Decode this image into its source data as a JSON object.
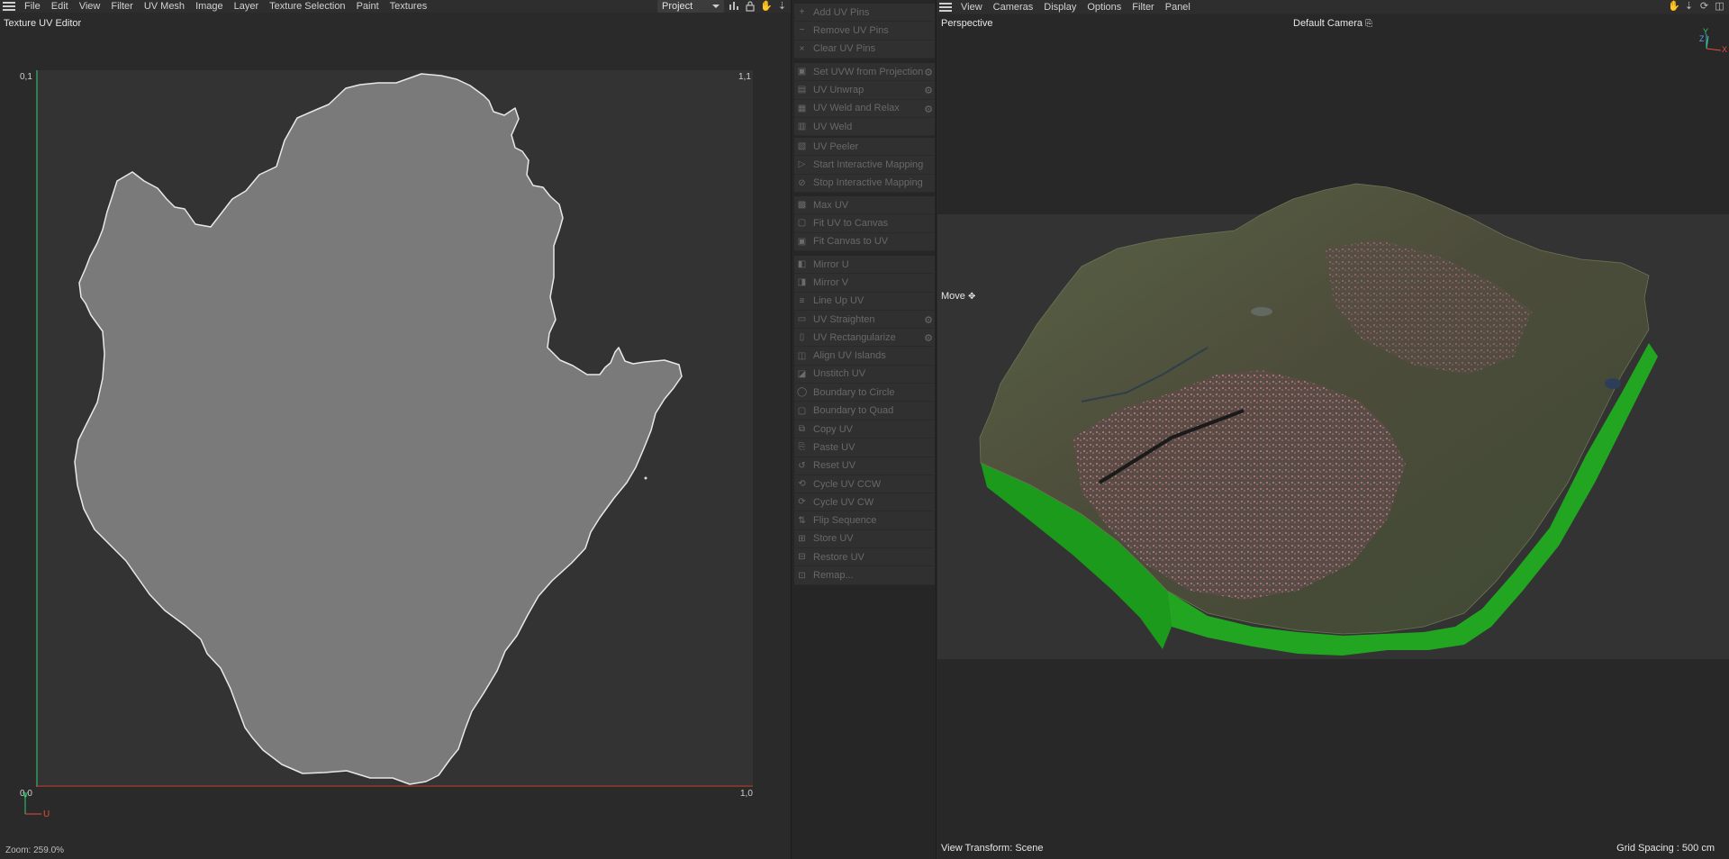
{
  "uv_editor": {
    "menu": [
      "File",
      "Edit",
      "View",
      "Filter",
      "UV Mesh",
      "Image",
      "Layer",
      "Texture Selection",
      "Paint",
      "Textures"
    ],
    "project_select": "Project",
    "title": "Texture UV Editor",
    "corner_labels": {
      "top_left": "0,1",
      "top_right": "1,1",
      "bottom_left": "0,0",
      "bottom_right": "1,0"
    },
    "axis_v": "V",
    "axis_u": "U",
    "zoom": "Zoom: 259.0%",
    "colors": {
      "canvas": "#333333",
      "island_fill": "#7a7a7a",
      "island_outline": "#e8e8e8",
      "u_axis": "#c0392b",
      "v_axis": "#2ecc71"
    }
  },
  "uv_commands": {
    "groups": [
      [
        {
          "label": "Add UV Pins",
          "icon": "pin-add-icon",
          "gear": false
        },
        {
          "label": "Remove UV Pins",
          "icon": "pin-remove-icon",
          "gear": false
        },
        {
          "label": "Clear UV Pins",
          "icon": "pin-clear-icon",
          "gear": false
        }
      ],
      [
        {
          "label": "Set UVW from Projection",
          "icon": "projection-icon",
          "gear": true
        },
        {
          "label": "UV Unwrap",
          "icon": "unwrap-icon",
          "gear": true
        },
        {
          "label": "UV Weld and Relax",
          "icon": "weld-relax-icon",
          "gear": true
        },
        {
          "label": "UV Weld",
          "icon": "weld-icon",
          "gear": false
        }
      ],
      [
        {
          "label": "UV Peeler",
          "icon": "peeler-icon",
          "gear": false
        },
        {
          "label": "Start Interactive Mapping",
          "icon": "play-icon",
          "gear": false
        },
        {
          "label": "Stop Interactive Mapping",
          "icon": "stop-icon",
          "gear": false
        }
      ],
      [
        {
          "label": "Max UV",
          "icon": "max-uv-icon",
          "gear": false
        },
        {
          "label": "Fit UV to Canvas",
          "icon": "fit-uv-icon",
          "gear": false
        },
        {
          "label": "Fit Canvas to UV",
          "icon": "fit-canvas-icon",
          "gear": false
        }
      ],
      [
        {
          "label": "Mirror U",
          "icon": "mirror-u-icon",
          "gear": false
        },
        {
          "label": "Mirror V",
          "icon": "mirror-v-icon",
          "gear": false
        },
        {
          "label": "Line Up UV",
          "icon": "line-up-icon",
          "gear": false
        },
        {
          "label": "UV Straighten",
          "icon": "straighten-icon",
          "gear": true
        },
        {
          "label": "UV Rectangularize",
          "icon": "rectangularize-icon",
          "gear": true
        },
        {
          "label": "Align UV Islands",
          "icon": "align-icon",
          "gear": false
        },
        {
          "label": "Unstitch UV",
          "icon": "unstitch-icon",
          "gear": false
        },
        {
          "label": "Boundary to Circle",
          "icon": "circle-icon",
          "gear": false
        },
        {
          "label": "Boundary to Quad",
          "icon": "quad-icon",
          "gear": false
        }
      ],
      [
        {
          "label": "Copy UV",
          "icon": "copy-icon",
          "gear": false
        },
        {
          "label": "Paste UV",
          "icon": "paste-icon",
          "gear": false
        },
        {
          "label": "Reset UV",
          "icon": "reset-icon",
          "gear": false
        },
        {
          "label": "Cycle UV CCW",
          "icon": "cycle-ccw-icon",
          "gear": false
        },
        {
          "label": "Cycle UV CW",
          "icon": "cycle-cw-icon",
          "gear": false
        },
        {
          "label": "Flip Sequence",
          "icon": "flip-icon",
          "gear": false
        },
        {
          "label": "Store UV",
          "icon": "store-icon",
          "gear": false
        },
        {
          "label": "Restore UV",
          "icon": "restore-icon",
          "gear": false
        },
        {
          "label": "Remap...",
          "icon": "remap-icon",
          "gear": false
        }
      ]
    ]
  },
  "viewport": {
    "menu": [
      "View",
      "Cameras",
      "Display",
      "Options",
      "Filter",
      "Panel"
    ],
    "projection": "Perspective",
    "camera": "Default Camera",
    "tool": "Move",
    "view_transform": "View Transform: Scene",
    "grid_spacing": "Grid Spacing : 500 cm",
    "axis_x": "X",
    "axis_y": "Y",
    "axis_z": "Z",
    "colors": {
      "ground": "#333333",
      "terrain_side": "#1fa51f",
      "terrain_top": "#4a5138"
    }
  }
}
